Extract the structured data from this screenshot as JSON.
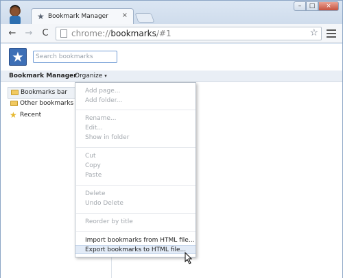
{
  "tab": {
    "title": "Bookmark Manager",
    "close": "×",
    "star_icon": "star-icon"
  },
  "window_controls": {
    "minimize": "–",
    "maximize": "□",
    "close": "×"
  },
  "toolbar": {
    "back": "←",
    "forward": "→",
    "reload": "C",
    "url_scheme": "chrome://",
    "url_host": "bookmarks",
    "url_path": "/#1",
    "star": "☆"
  },
  "header": {
    "logo": "★",
    "search_placeholder": "Search bookmarks"
  },
  "bm_bar": {
    "title": "Bookmark Manager",
    "organize": "Organize",
    "caret": "▾"
  },
  "tree": [
    {
      "label": "Bookmarks bar",
      "icon": "folder-icon"
    },
    {
      "label": "Other bookmarks",
      "icon": "folder-icon"
    },
    {
      "label": "Recent",
      "icon": "star-icon"
    }
  ],
  "menu": {
    "add_page": "Add page...",
    "add_folder": "Add folder...",
    "rename": "Rename...",
    "edit": "Edit...",
    "show_in_folder": "Show in folder",
    "cut": "Cut",
    "copy": "Copy",
    "paste": "Paste",
    "delete": "Delete",
    "undo_delete": "Undo Delete",
    "reorder": "Reorder by title",
    "import": "Import bookmarks from HTML file...",
    "export": "Export bookmarks to HTML file..."
  },
  "colors": {
    "logo_bg": "#3d6fb6",
    "folder": "#f1c961",
    "hover": "#e2ebf7"
  }
}
